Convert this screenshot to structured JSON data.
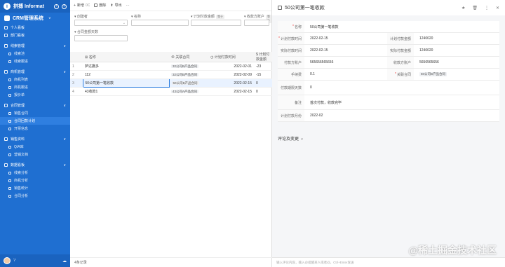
{
  "sidebar": {
    "brand": "拼搏 Informat",
    "app_name": "CRM管理系统",
    "app_sub": "∨",
    "items": [
      {
        "label": "个人看板"
      },
      {
        "label": "部门看板"
      }
    ],
    "groups": [
      {
        "label": "线索管理",
        "subs": [
          "线索池",
          "线索跟进"
        ]
      },
      {
        "label": "商机管理",
        "subs": [
          "商机列表",
          "商机跟进",
          "报价单"
        ]
      },
      {
        "label": "合同管理",
        "subs": [
          "销售合同",
          "合同回款计划",
          "开票信息"
        ]
      },
      {
        "label": "销售资料",
        "subs": [
          "Q/A库",
          "营销文档"
        ]
      },
      {
        "label": "数据看板",
        "subs": [
          "线索分析",
          "商机分析",
          "销售统计",
          "合同分析"
        ]
      }
    ]
  },
  "toolbar": {
    "new_label": "新增",
    "new_count": "0C",
    "delete_label": "删除",
    "export_label": "导出",
    "more_label": "⋯"
  },
  "filters": {
    "label1": "创建者",
    "label2": "名称",
    "label3": "计划付款金额",
    "tag3": "等于",
    "label4": "收款方账户",
    "tag4": "等于",
    "label5": "合同金额天数"
  },
  "table": {
    "headers": {
      "name": "名称",
      "rel": "关联合同",
      "date": "计划付款时间",
      "amt": "计划付款金额"
    },
    "rows": [
      {
        "idx": "1",
        "name": "萨达撒多",
        "rel": "32公司B产品合同",
        "date": "2022-02-01",
        "amt": "-23"
      },
      {
        "idx": "2",
        "name": "112",
        "rel": "32公司B产品合同",
        "date": "2022-02-09",
        "amt": "-15"
      },
      {
        "idx": "3",
        "name": "50公司第一笔收款",
        "rel": "50公司B产品合同",
        "date": "2022-02-15",
        "amt": "0"
      },
      {
        "idx": "4",
        "name": "43收款1",
        "rel": "43公司A产品合同",
        "date": "2022-02-15",
        "amt": "0"
      }
    ],
    "footer": "4条记录"
  },
  "detail": {
    "title": "50公司第一笔收款",
    "fields": {
      "name_label": "名称",
      "name_value": "50公司第一笔收款",
      "plan_time_label": "计划付款时间",
      "plan_time_value": "2022-02-15",
      "plan_amt_label": "计划付款金额",
      "plan_amt_value": "1240020",
      "real_time_label": "实际付款时间",
      "real_time_value": "2022-02-15",
      "real_amt_label": "实际付款金额",
      "real_amt_value": "1240020",
      "pay_acct_label": "付款方账户",
      "pay_acct_value": "565656565656",
      "recv_acct_label": "收款方账户",
      "recv_acct_value": "5656565656",
      "fee_label": "手续费",
      "fee_value": "0.1",
      "contract_label": "关联合同",
      "contract_value": "50公司B产品合同",
      "days_label": "付款期限天数",
      "days_value": "0",
      "note_label": "备注",
      "note_value": "首次付款，收款完毕",
      "month_label": "计划付款月份",
      "month_value": "2022-02"
    },
    "section_label": "评论及变更",
    "comment_placeholder": "输入评论内容，输入@提醒某人或者@，Ctrl+Enter发送",
    "watermark": "@稀土掘金技术社区"
  }
}
